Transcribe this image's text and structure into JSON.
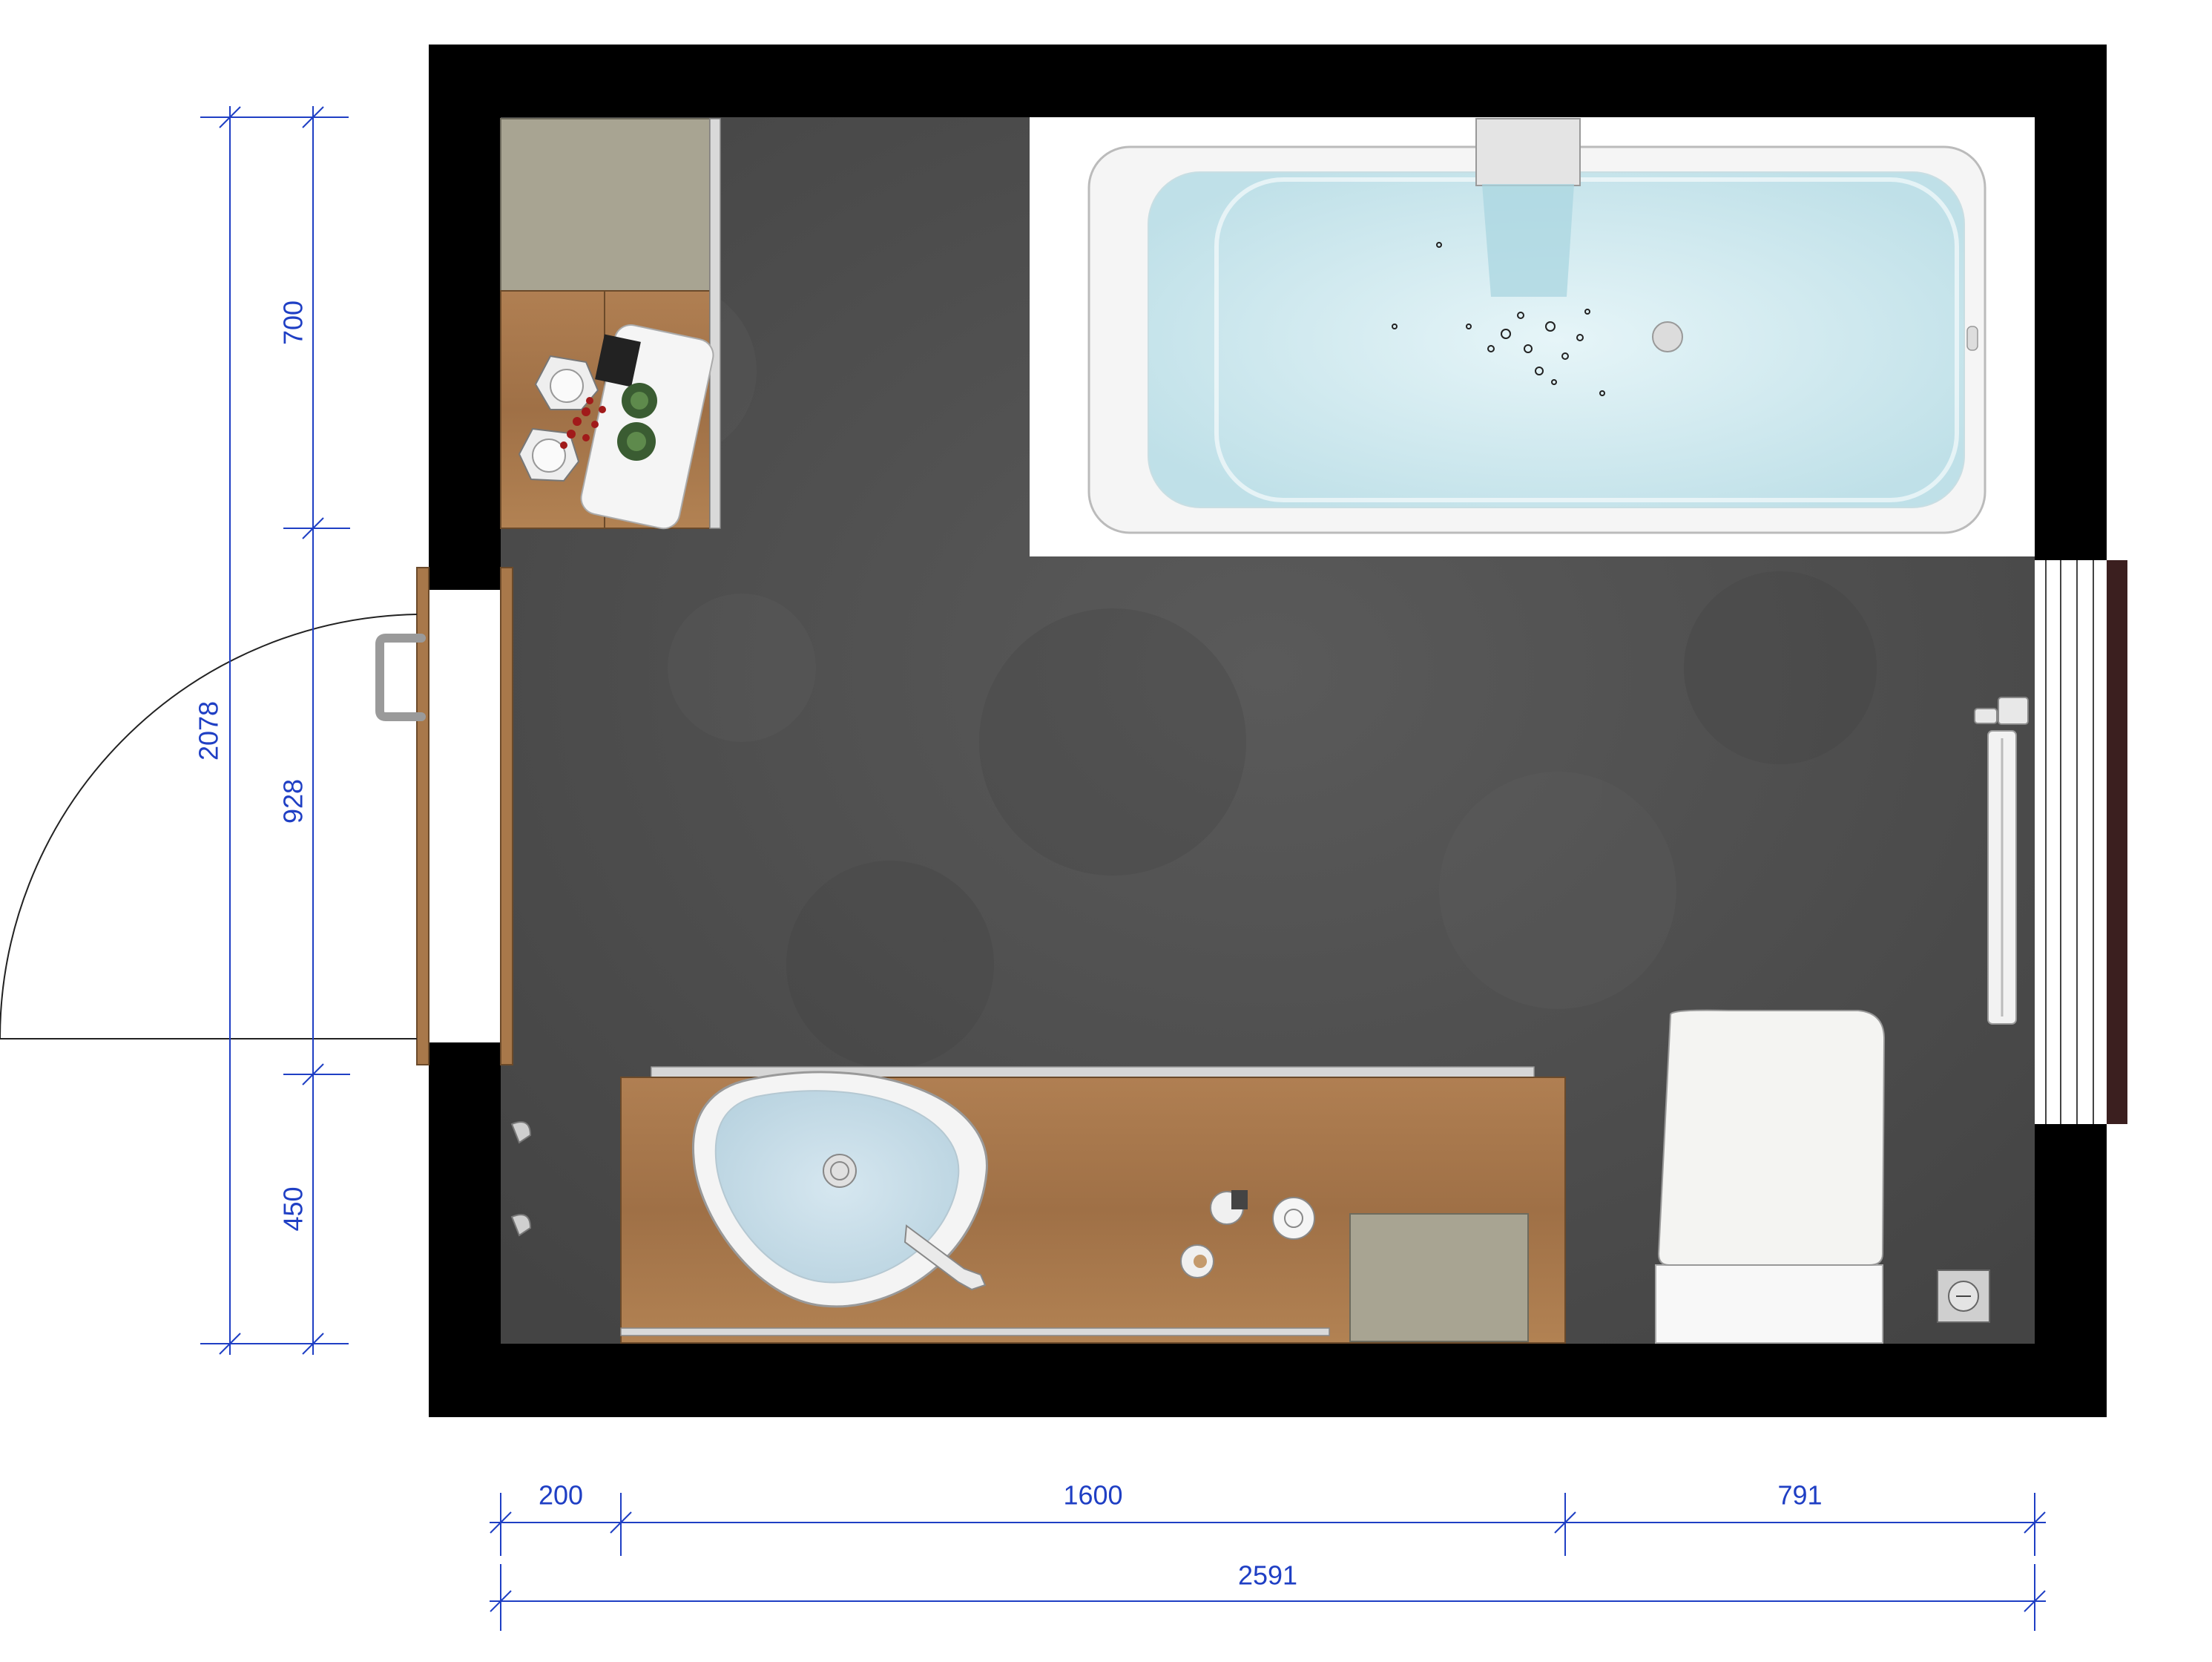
{
  "dimensions": {
    "vertical": {
      "total": "2078",
      "segment_top": "700",
      "segment_middle": "928",
      "segment_bottom": "450"
    },
    "horizontal": {
      "total": "2591",
      "segment_left": "200",
      "segment_middle": "1600",
      "segment_right": "791"
    }
  },
  "colors": {
    "wall": "#000000",
    "floor": "#4e4e4e",
    "wood": "#a8784a",
    "cabinet": "#a8a492",
    "dimension": "#1f3fc4",
    "bath_water": "#cfe9ef",
    "ceramic": "#f4f4f2"
  },
  "icons": {
    "bathtub": "bathtub-icon",
    "sink": "sink-icon",
    "toilet": "toilet-icon",
    "radiator": "radiator-icon",
    "door": "door-icon",
    "window": "window-icon",
    "plant": "plant-icon",
    "faucet": "faucet-icon",
    "floor_drain": "floor-drain-icon"
  }
}
